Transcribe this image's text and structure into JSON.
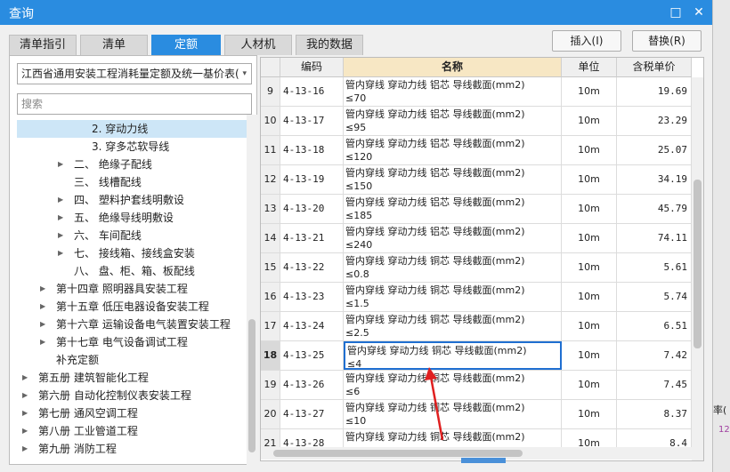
{
  "window": {
    "title": "查询",
    "restore_glyph": "□",
    "close_glyph": "✕"
  },
  "tabs": [
    {
      "label": "清单指引"
    },
    {
      "label": "清单"
    },
    {
      "label": "定额"
    },
    {
      "label": "人材机"
    },
    {
      "label": "我的数据"
    }
  ],
  "actions": {
    "insert": "插入(I)",
    "replace": "替换(R)"
  },
  "library": {
    "selected": "江西省通用安装工程消耗量定额及统一基价表(",
    "arrow": "▾"
  },
  "search": {
    "placeholder": "搜索"
  },
  "tree": [
    {
      "label": "2. 穿动力线",
      "selected": true
    },
    {
      "label": "3. 穿多芯软导线"
    },
    {
      "label": "二、 绝缘子配线",
      "expandable": true
    },
    {
      "label": "三、 线槽配线"
    },
    {
      "label": "四、 塑料护套线明敷设",
      "expandable": true
    },
    {
      "label": "五、 绝缘导线明敷设",
      "expandable": true
    },
    {
      "label": "六、 车间配线",
      "expandable": true
    },
    {
      "label": "七、 接线箱、接线盒安装",
      "expandable": true
    },
    {
      "label": "八、 盘、柜、箱、板配线"
    },
    {
      "label": "第十四章 照明器具安装工程",
      "expandable": true
    },
    {
      "label": "第十五章 低压电器设备安装工程",
      "expandable": true
    },
    {
      "label": "第十六章 运输设备电气装置安装工程",
      "expandable": true
    },
    {
      "label": "第十七章 电气设备调试工程",
      "expandable": true
    },
    {
      "label": "补充定额"
    },
    {
      "label": "第五册 建筑智能化工程",
      "expandable": true
    },
    {
      "label": "第六册 自动化控制仪表安装工程",
      "expandable": true
    },
    {
      "label": "第七册 通风空调工程",
      "expandable": true
    },
    {
      "label": "第八册 工业管道工程",
      "expandable": true
    },
    {
      "label": "第九册 消防工程",
      "expandable": true
    }
  ],
  "grid": {
    "headers": {
      "code": "编码",
      "name": "名称",
      "unit": "单位",
      "price": "含税单价"
    },
    "rows": [
      {
        "no": "9",
        "code": "4-13-16",
        "name": "管内穿线 穿动力线 铝芯 导线截面(mm2)\n≤70",
        "unit": "10m",
        "price": "19.69"
      },
      {
        "no": "10",
        "code": "4-13-17",
        "name": "管内穿线 穿动力线 铝芯 导线截面(mm2)\n≤95",
        "unit": "10m",
        "price": "23.29"
      },
      {
        "no": "11",
        "code": "4-13-18",
        "name": "管内穿线 穿动力线 铝芯 导线截面(mm2)\n≤120",
        "unit": "10m",
        "price": "25.07"
      },
      {
        "no": "12",
        "code": "4-13-19",
        "name": "管内穿线 穿动力线 铝芯 导线截面(mm2)\n≤150",
        "unit": "10m",
        "price": "34.19"
      },
      {
        "no": "13",
        "code": "4-13-20",
        "name": "管内穿线 穿动力线 铝芯 导线截面(mm2)\n≤185",
        "unit": "10m",
        "price": "45.79"
      },
      {
        "no": "14",
        "code": "4-13-21",
        "name": "管内穿线 穿动力线 铝芯 导线截面(mm2)\n≤240",
        "unit": "10m",
        "price": "74.11"
      },
      {
        "no": "15",
        "code": "4-13-22",
        "name": "管内穿线 穿动力线 铜芯 导线截面(mm2)\n≤0.8",
        "unit": "10m",
        "price": "5.61"
      },
      {
        "no": "16",
        "code": "4-13-23",
        "name": "管内穿线 穿动力线 铜芯 导线截面(mm2)\n≤1.5",
        "unit": "10m",
        "price": "5.74"
      },
      {
        "no": "17",
        "code": "4-13-24",
        "name": "管内穿线 穿动力线 铜芯 导线截面(mm2)\n≤2.5",
        "unit": "10m",
        "price": "6.51"
      },
      {
        "no": "18",
        "code": "4-13-25",
        "name": "管内穿线 穿动力线 铜芯 导线截面(mm2)\n≤4",
        "unit": "10m",
        "price": "7.42",
        "selected": true
      },
      {
        "no": "19",
        "code": "4-13-26",
        "name": "管内穿线 穿动力线 铜芯 导线截面(mm2)\n≤6",
        "unit": "10m",
        "price": "7.45"
      },
      {
        "no": "20",
        "code": "4-13-27",
        "name": "管内穿线 穿动力线 铜芯 导线截面(mm2)\n≤10",
        "unit": "10m",
        "price": "8.37"
      },
      {
        "no": "21",
        "code": "4-13-28",
        "name": "管内穿线 穿动力线 铜芯 导线截面(mm2)",
        "unit": "10m",
        "price": "8.4"
      }
    ]
  },
  "background": {
    "partial_label": "率(",
    "partial_value": "12"
  },
  "annotation": {
    "color": "#e02020"
  }
}
